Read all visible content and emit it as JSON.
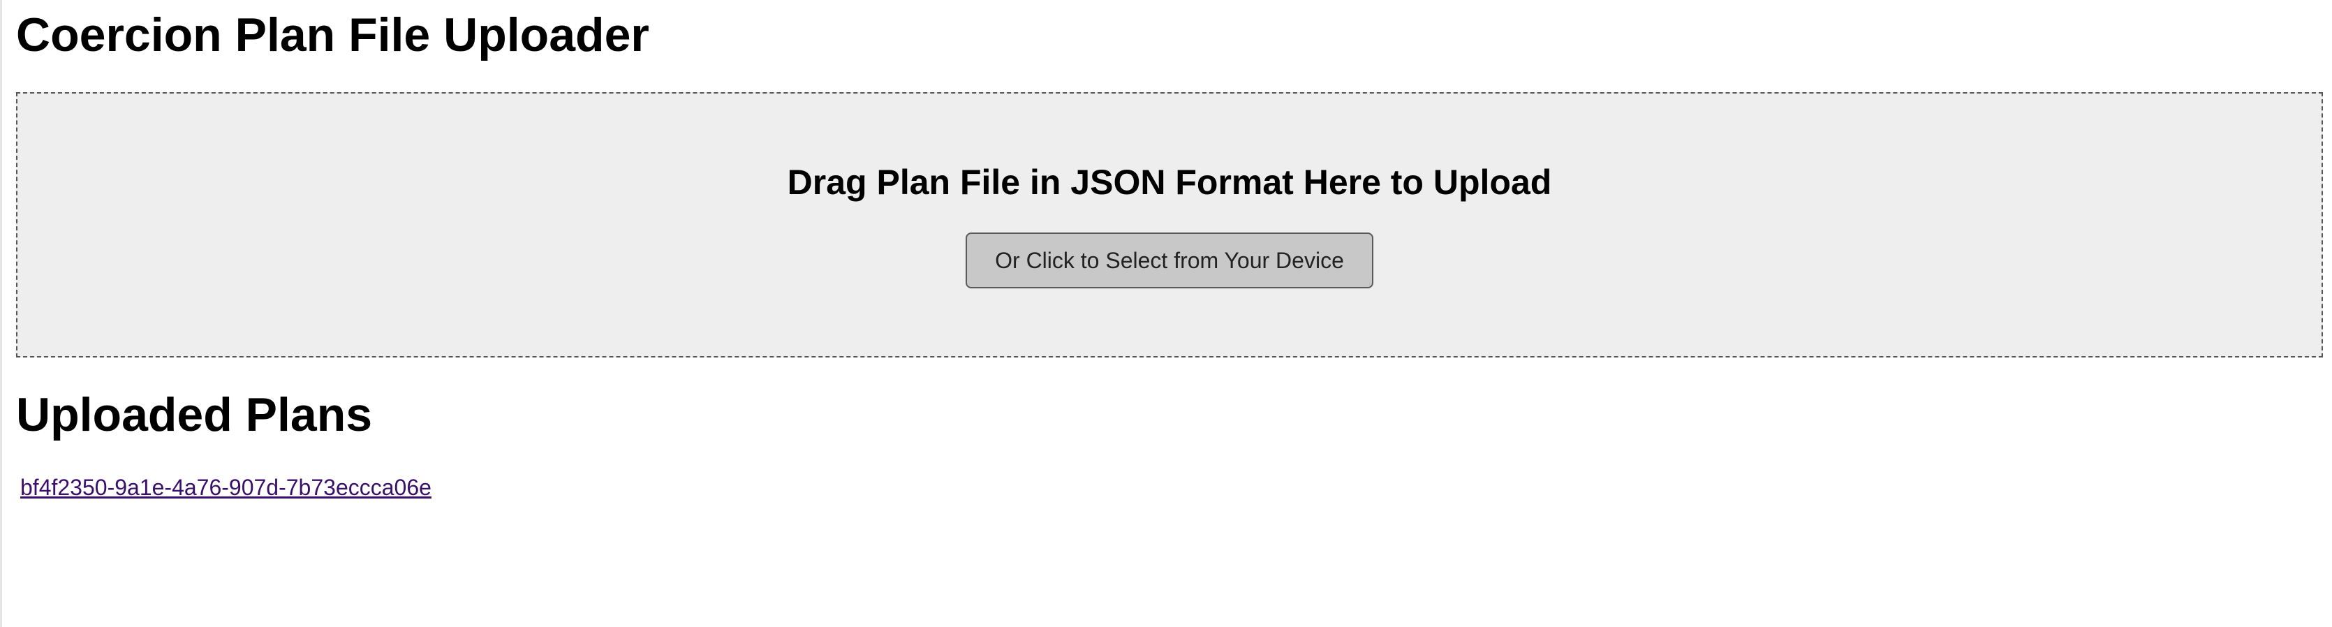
{
  "header": {
    "title": "Coercion Plan File Uploader"
  },
  "dropzone": {
    "heading": "Drag Plan File in JSON Format Here to Upload",
    "button_label": "Or Click to Select from Your Device"
  },
  "uploaded": {
    "title": "Uploaded Plans",
    "plans": [
      {
        "id": "bf4f2350-9a1e-4a76-907d-7b73eccca06e"
      }
    ]
  }
}
